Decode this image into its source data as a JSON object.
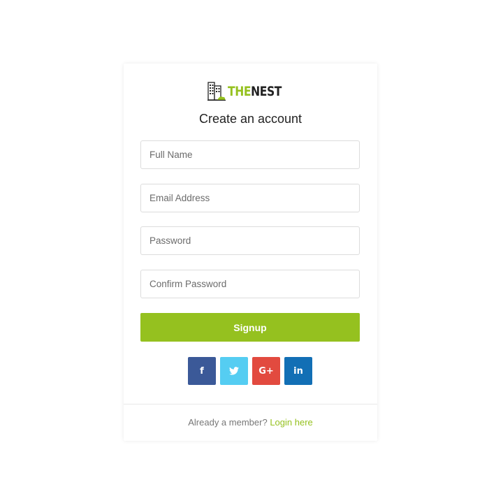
{
  "colors": {
    "accent": "#95c11f",
    "facebook": "#3b5998",
    "twitter": "#55cdf2",
    "google_plus": "#e24a3f",
    "linkedin": "#126fb5"
  },
  "brand": {
    "icon": "building-icon",
    "part1": "THE",
    "part2": "NEST"
  },
  "title": "Create an account",
  "form": {
    "full_name": {
      "value": "",
      "placeholder": "Full Name"
    },
    "email": {
      "value": "",
      "placeholder": "Email Address"
    },
    "password": {
      "value": "",
      "placeholder": "Password"
    },
    "confirm_password": {
      "value": "",
      "placeholder": "Confirm Password"
    },
    "submit_label": "Signup"
  },
  "social": [
    {
      "icon": "facebook-icon",
      "glyph": "f"
    },
    {
      "icon": "twitter-icon",
      "glyph": "t"
    },
    {
      "icon": "google-plus-icon",
      "glyph": "G+"
    },
    {
      "icon": "linkedin-icon",
      "glyph": "in"
    }
  ],
  "footer": {
    "text": "Already a member?",
    "link": "Login here"
  }
}
